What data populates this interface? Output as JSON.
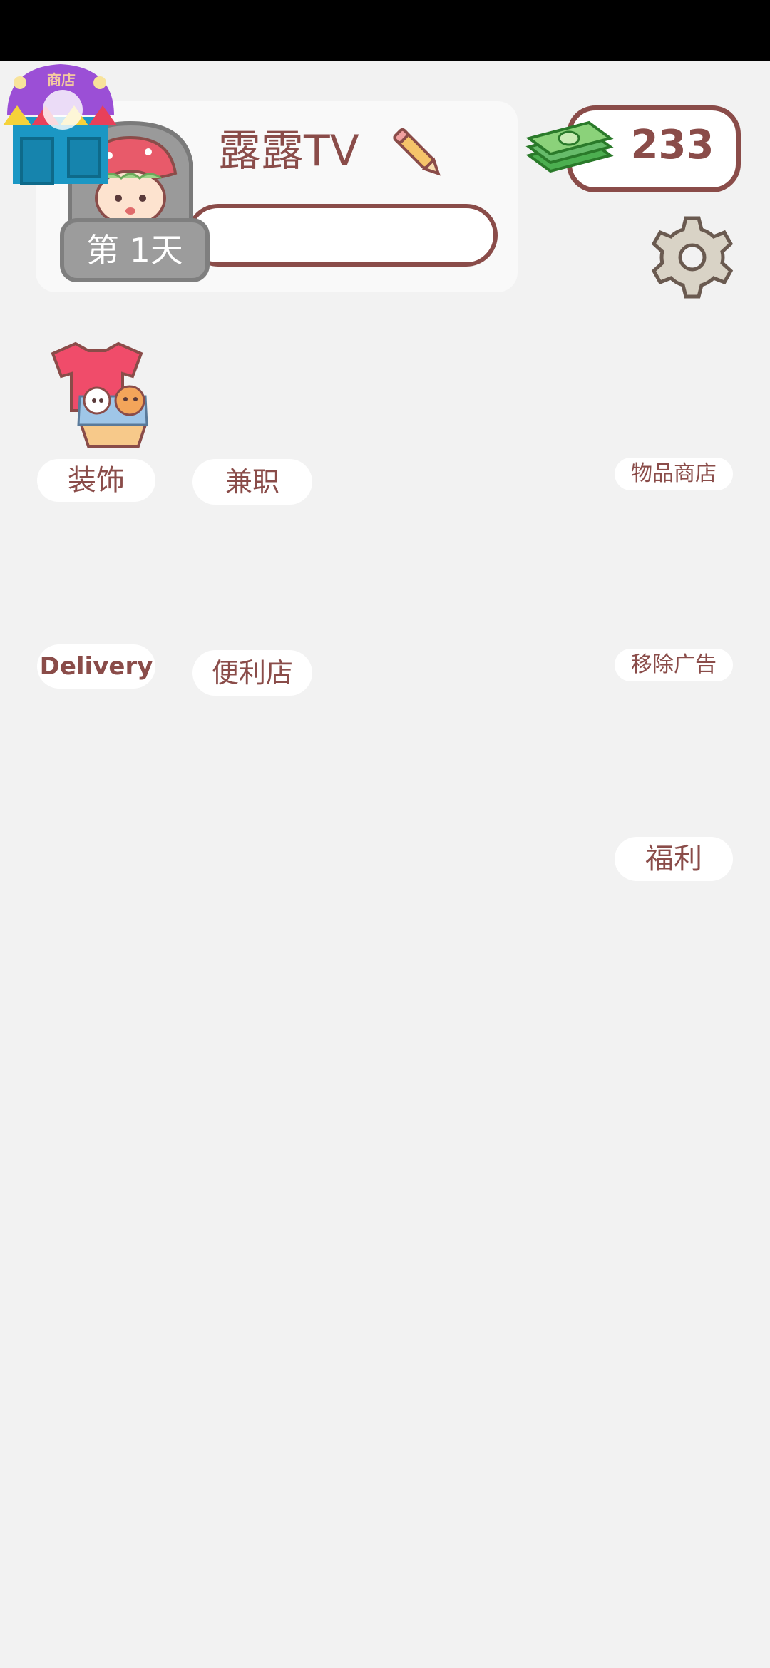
{
  "profile": {
    "name": "露露TV",
    "day": "第 1天"
  },
  "shop_icon": {
    "label": "商店"
  },
  "currency": {
    "value": "233"
  },
  "menu": {
    "decor": "装饰",
    "part_time": "兼职",
    "item_shop": "物品商店",
    "delivery": "Delivery",
    "convenience_store": "便利店",
    "remove_ads": "移除广告",
    "welfare": "福利"
  },
  "icons": {
    "pencil": "pencil-icon",
    "cash": "cash-icon",
    "settings": "gear-icon",
    "decor": "clothes-basket-icon",
    "shop": "shop-icon",
    "avatar": "strawberry-avatar-icon"
  },
  "colors": {
    "text": "#8a4c49",
    "background": "#f2f2f2",
    "card": "#f9f9f9"
  }
}
